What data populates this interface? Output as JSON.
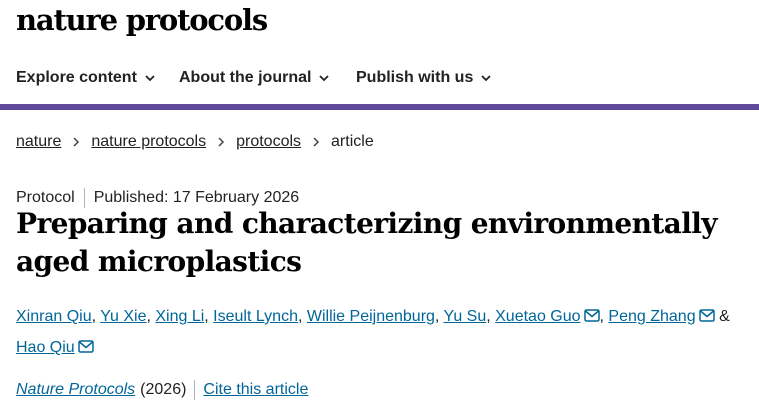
{
  "site": {
    "logo": "nature protocols"
  },
  "nav": {
    "items": [
      {
        "label": "Explore content"
      },
      {
        "label": "About the journal"
      },
      {
        "label": "Publish with us"
      }
    ]
  },
  "breadcrumb": [
    "nature",
    "nature protocols",
    "protocols",
    "article"
  ],
  "article": {
    "type": "Protocol",
    "published": "Published: 17 February 2026",
    "title": "Preparing and characterizing environmentally aged microplastics",
    "authors": [
      "Xinran Qiu",
      "Yu Xie",
      "Xing Li",
      "Iseult Lynch",
      "Willie Peijnenburg",
      "Yu Su",
      "Xuetao Guo",
      "Peng Zhang",
      "Hao Qiu"
    ],
    "and_sign": "&",
    "journal": "Nature Protocols",
    "year": "(2026)",
    "cite": "Cite this article"
  },
  "colors": {
    "accent": "#5e4a98",
    "link": "#006699"
  },
  "icons": [
    "chevron-down-icon",
    "chevron-right-icon",
    "mail-icon"
  ]
}
